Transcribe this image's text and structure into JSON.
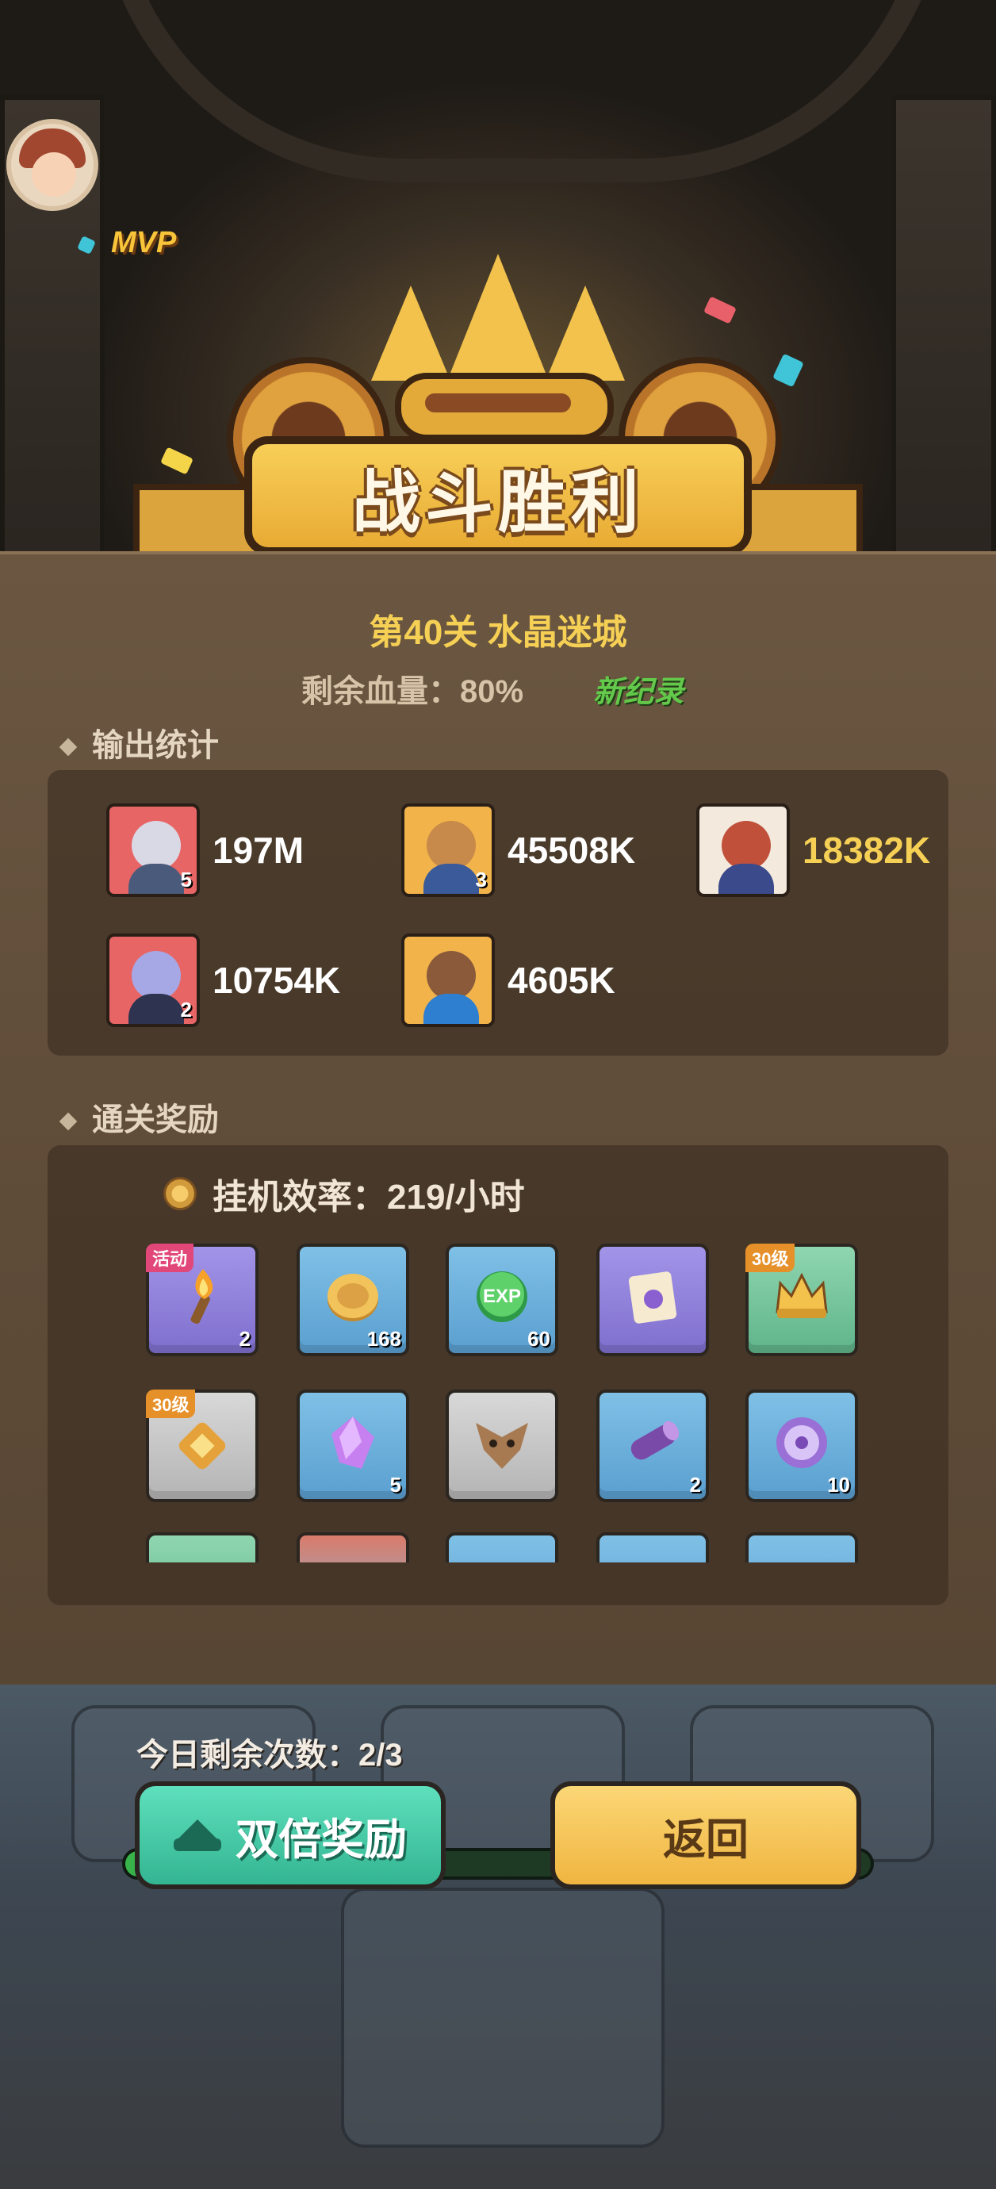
{
  "banner": {
    "title": "战斗胜利"
  },
  "stage": {
    "label": "第40关 水晶迷城"
  },
  "hp": {
    "label": "剩余血量：80%",
    "badge": "新纪录"
  },
  "output_stats": {
    "title": "输出统计",
    "mvp_label": "MVP",
    "heroes": [
      {
        "value": "197M",
        "level": "5",
        "color": "#e86565",
        "highlight": false
      },
      {
        "value": "45508K",
        "level": "3",
        "color": "#f2b34a",
        "highlight": false
      },
      {
        "value": "18382K",
        "level": "",
        "color": "#f3e9dc",
        "highlight": true
      },
      {
        "value": "10754K",
        "level": "2",
        "color": "#e86565",
        "highlight": false
      },
      {
        "value": "4605K",
        "level": "",
        "color": "#f2b34a",
        "highlight": false
      }
    ]
  },
  "rewards": {
    "title": "通关奖励",
    "efficiency": "挂机效率：219/小时",
    "items": [
      {
        "icon": "torch-icon",
        "tag": "活动",
        "count": "2",
        "rarity": "purple"
      },
      {
        "icon": "gold-coin-icon",
        "tag": "",
        "count": "168",
        "rarity": "blue"
      },
      {
        "icon": "exp-orb-icon",
        "tag": "",
        "count": "60",
        "rarity": "blue"
      },
      {
        "icon": "integral-scroll-icon",
        "tag": "",
        "count": "",
        "rarity": "purple"
      },
      {
        "icon": "gold-crown-icon",
        "tag": "30级",
        "count": "",
        "rarity": "green"
      },
      {
        "icon": "amulet-icon",
        "tag": "30级",
        "count": "",
        "rarity": "grey"
      },
      {
        "icon": "crystal-icon",
        "tag": "",
        "count": "5",
        "rarity": "blue"
      },
      {
        "icon": "eagle-mask-icon",
        "tag": "",
        "count": "",
        "rarity": "grey"
      },
      {
        "icon": "wood-log-icon",
        "tag": "",
        "count": "2",
        "rarity": "blue"
      },
      {
        "icon": "rune-badge-icon",
        "tag": "",
        "count": "10",
        "rarity": "blue"
      }
    ]
  },
  "daily": {
    "remaining": "今日剩余次数：2/3"
  },
  "buttons": {
    "double": "双倍奖励",
    "back": "返回"
  }
}
